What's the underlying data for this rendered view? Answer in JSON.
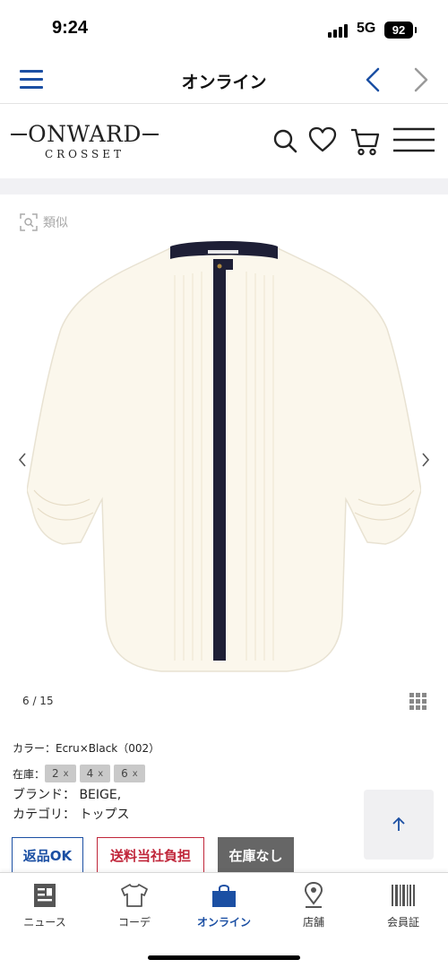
{
  "status_bar": {
    "time": "9:24",
    "network": "5G",
    "battery": "92"
  },
  "browser": {
    "title": "オンライン"
  },
  "site": {
    "logo_main": "ONWARD",
    "logo_sub": "CROSSET"
  },
  "gallery": {
    "similar_label": "類似",
    "counter": "6 / 15"
  },
  "product": {
    "color_line": "カラー：Ecru×Black（002）",
    "stock_label": "在庫：",
    "sizes": [
      {
        "size": "2",
        "mark": "x"
      },
      {
        "size": "4",
        "mark": "x"
      },
      {
        "size": "6",
        "mark": "x"
      }
    ],
    "brand_line": "ブランド： BEIGE,",
    "category_line": "カテゴリ： トップス"
  },
  "badges": {
    "returns": "返品OK",
    "shipping": "送料当社負担",
    "stock": "在庫なし"
  },
  "bottom_nav": [
    {
      "label": "ニュース",
      "icon": "news-icon"
    },
    {
      "label": "コーデ",
      "icon": "tshirt-icon"
    },
    {
      "label": "オンライン",
      "icon": "shopping-bag-icon",
      "active": true
    },
    {
      "label": "店舗",
      "icon": "map-pin-icon"
    },
    {
      "label": "会員証",
      "icon": "barcode-icon"
    }
  ],
  "colors": {
    "accent": "#1b4fa3",
    "shipping_red": "#c0263a",
    "stock_gray": "#666666"
  }
}
